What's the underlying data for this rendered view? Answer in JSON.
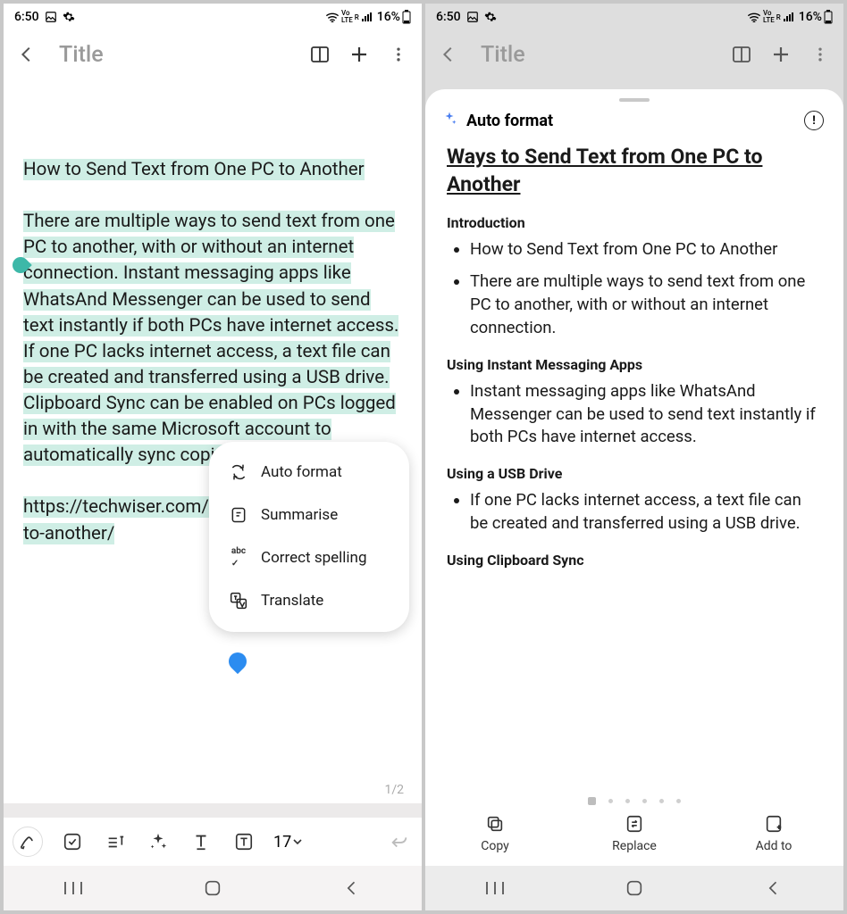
{
  "status": {
    "time": "6:50",
    "battery_pct": "16%",
    "indicators": {
      "lte": "Vo LTE",
      "r": "R"
    }
  },
  "header": {
    "title": "Title"
  },
  "note": {
    "line_title": "How to Send Text from One PC to Another",
    "para": "There are multiple ways to send text from one PC to another, with or without an internet connection. Instant messaging apps like WhatsAnd Messenger can be used to send text instantly if both PCs have internet access. If one PC lacks internet access, a text file can be created and transferred using a USB drive. Clipboard Sync can be enabled on PCs logged in with the same Microsoft account to automatically sync copied text.",
    "url": "https://techwiser.com/send-text-from-one-pc-to-another/",
    "page_counter": "1/2"
  },
  "context_menu": {
    "items": [
      {
        "label": "Auto format"
      },
      {
        "label": "Summarise"
      },
      {
        "label": "Correct spelling"
      },
      {
        "label": "Translate"
      }
    ]
  },
  "toolbar": {
    "font_size": "17"
  },
  "sheet": {
    "header": "Auto format",
    "doc_title": "Ways to Send Text from One PC to Another",
    "sections": [
      {
        "heading": "Introduction",
        "bullets": [
          "How to Send Text from One PC to Another",
          "There are multiple ways to send text from one PC to another, with or without an internet connection."
        ]
      },
      {
        "heading": "Using Instant Messaging Apps",
        "bullets": [
          "Instant messaging apps like WhatsAnd Messenger can be used to send text instantly if both PCs have internet access."
        ]
      },
      {
        "heading": "Using a USB Drive",
        "bullets": [
          "If one PC lacks internet access, a text file can be created and transferred using a USB drive."
        ]
      },
      {
        "heading": "Using Clipboard Sync",
        "bullets": []
      }
    ],
    "actions": {
      "copy": "Copy",
      "replace": "Replace",
      "addto": "Add to"
    }
  }
}
